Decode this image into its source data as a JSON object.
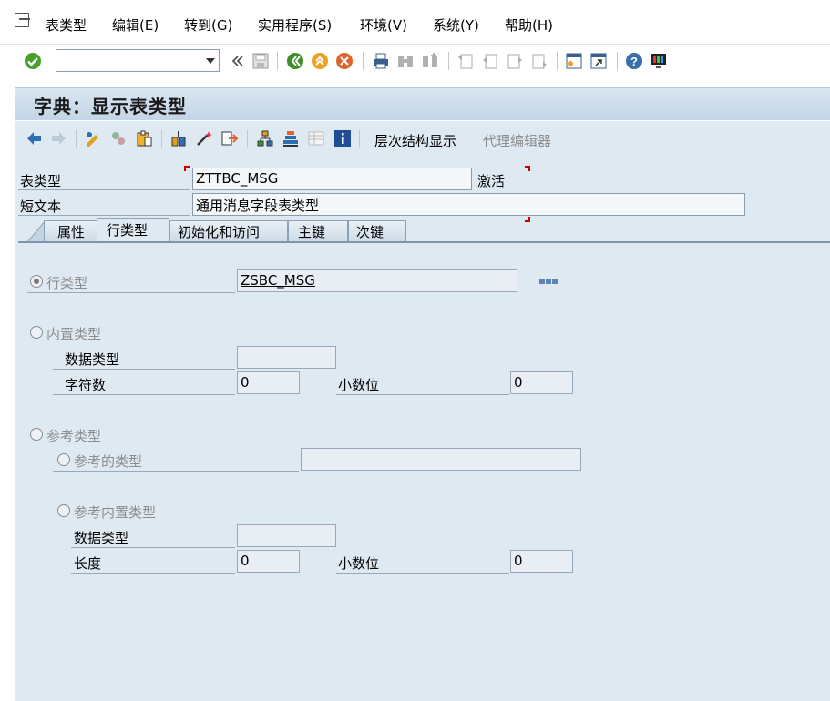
{
  "menu": {
    "items": [
      "表类型",
      "编辑(E)",
      "转到(G)",
      "实用程序(S)",
      "环境(V)",
      "系统(Y)",
      "帮助(H)"
    ]
  },
  "toolbar": {
    "command_value": "",
    "icons": [
      "enter-icon",
      "back-double-icon",
      "save-icon",
      "back-icon",
      "exit-icon",
      "cancel-icon",
      "print-icon",
      "find-icon",
      "find-next-icon",
      "first-page-icon",
      "prev-page-icon",
      "next-page-icon",
      "last-page-icon",
      "new-session-icon",
      "shortcut-icon",
      "help-icon",
      "layout-icon"
    ]
  },
  "title": {
    "text": "字典：显示表类型"
  },
  "app_toolbar": {
    "hierarchy_label": "层次结构显示",
    "proxy_editor_label": "代理编辑器"
  },
  "header": {
    "table_type_label": "表类型",
    "table_type_value": "ZTTBC_MSG",
    "status": "激活",
    "short_text_label": "短文本",
    "short_text_value": "通用消息字段表类型"
  },
  "tabs": [
    "属性",
    "行类型",
    "初始化和访问",
    "主键",
    "次键"
  ],
  "active_tab": "行类型",
  "line_type": {
    "label": "行类型",
    "value": "ZSBC_MSG"
  },
  "builtin_type": {
    "label": "内置类型",
    "data_type_label": "数据类型",
    "data_type_value": "",
    "chars_label": "字符数",
    "chars_value": "0",
    "decimals_label": "小数位",
    "decimals_value": "0"
  },
  "ref_type": {
    "label": "参考类型",
    "ref_to_type_label": "参考的类型",
    "ref_to_type_value": "",
    "ref_builtin_label": "参考内置类型",
    "data_type_label": "数据类型",
    "data_type_value": "",
    "length_label": "长度",
    "length_value": "0",
    "decimals_label": "小数位",
    "decimals_value": "0"
  }
}
